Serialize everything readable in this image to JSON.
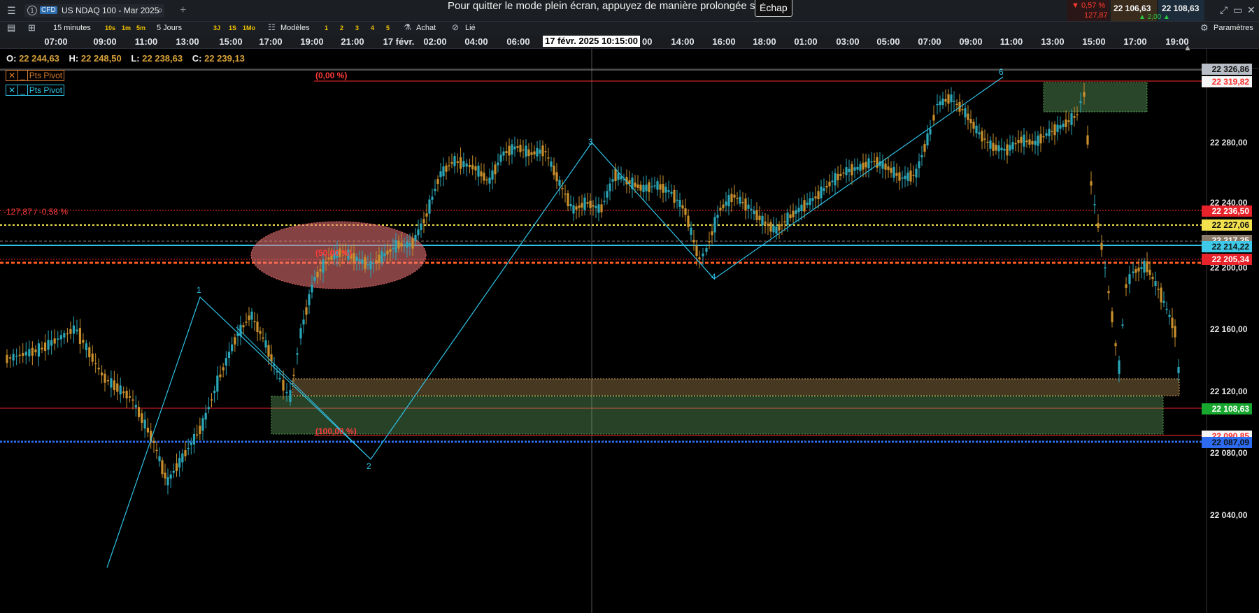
{
  "topbar": {
    "symbol_badge": "CFD",
    "symbol_name": "US NDAQ 100 - Mar 2025",
    "fullscreen_msg": "Pour quitter le mode plein écran, appuyez de manière prolongée sur",
    "esc_key": "Échap",
    "change_pct": "▼ 0,57 %",
    "change_pts": "127,87",
    "bid": "22 106,63",
    "ask": "22 108,63",
    "spread": "▲ 2,00 ▲",
    "colors": {
      "down": "#ff3b30",
      "up": "#27c93f",
      "bid_bg": "#3a2a1a",
      "ask_bg": "#1a2a3a"
    }
  },
  "toolbar": {
    "interval": "15 minutes",
    "presets": [
      "10s",
      "1m",
      "5m"
    ],
    "range": "5 Jours",
    "ranges": [
      "3J",
      "1S",
      "1Mo"
    ],
    "models": "Modèles",
    "layout_nums": [
      "1",
      "2",
      "3",
      "4",
      "5"
    ],
    "buy": "Achat",
    "link": "Lié",
    "settings": "Paramètres"
  },
  "timeaxis": {
    "ticks": [
      "07:00",
      "09:00",
      "11:00",
      "13:00",
      "15:00",
      "17:00",
      "19:00",
      "21:00",
      "17 févr.",
      "02:00",
      "04:00",
      "06:00",
      "",
      "",
      "14:00",
      "16:00",
      "18:00",
      "01:00",
      "03:00",
      "05:00",
      "07:00",
      "09:00",
      "11:00",
      "13:00",
      "15:00",
      "17:00",
      "19:00"
    ],
    "cursor_label": "17 févr. 2025 10:15:00",
    "cursor_trail": "00"
  },
  "ohlc": {
    "o_label": "O:",
    "o": "22 244,63",
    "h_label": "H:",
    "h": "22 248,50",
    "l_label": "L:",
    "l": "22 238,63",
    "c_label": "C:",
    "c": "22 239,13"
  },
  "indicators": [
    {
      "label": "Pts Pivot",
      "color": "#d9792a"
    },
    {
      "label": "Pts Pivot",
      "color": "#2ec3e6"
    }
  ],
  "annotations": {
    "fib_0": "(0,00 %)",
    "fib_50": "(50,00 %)",
    "fib_100": "(100,00 %)",
    "change_line": "-127,87 / -0,58 %",
    "wave_points": [
      "1",
      "2",
      "3",
      "4",
      "6"
    ]
  },
  "price_axis": {
    "labels": [
      "22 280,00",
      "22 240,00",
      "22 200,00",
      "22 160,00",
      "22 120,00",
      "22 080,00",
      "22 040,00"
    ],
    "tags": [
      {
        "text": "22 326,86",
        "color": "#111",
        "bg": "#b9bec6"
      },
      {
        "text": "22 319,82",
        "color": "#ff2d2d",
        "bg": "#f5f5f5"
      },
      {
        "text": "22 236,50",
        "color": "#fff",
        "bg": "#e8222a"
      },
      {
        "text": "22 227,06",
        "color": "#111",
        "bg": "#f2e24d"
      },
      {
        "text": "22 217,25",
        "color": "#fff",
        "bg": "#8a7a6a"
      },
      {
        "text": "22 214,22",
        "color": "#111",
        "bg": "#3ec9e8"
      },
      {
        "text": "22 205,34",
        "color": "#fff",
        "bg": "#e8222a"
      },
      {
        "text": "22 108,63",
        "color": "#fff",
        "bg": "#18a82f"
      },
      {
        "text": "22 090,85",
        "color": "#ff2d2d",
        "bg": "#f5f5f5"
      },
      {
        "text": "22 087,09",
        "color": "#111",
        "bg": "#2d6cf0"
      }
    ]
  },
  "chart_data": {
    "type": "candlestick",
    "y_axis_range": [
      22030,
      22335
    ],
    "colors": {
      "up": "#2aa6b8",
      "down": "#c98f2c"
    }
  }
}
